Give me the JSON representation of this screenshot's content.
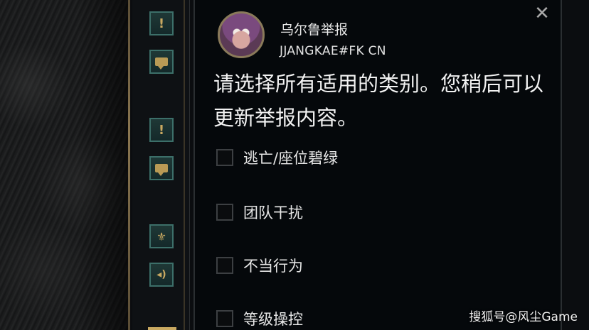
{
  "dialog": {
    "title": "乌尔鲁举报",
    "player_name": "JJANGKAE#FK CN",
    "instruction": "请选择所有适用的类别。您稍后可以更新举报内容。",
    "close_label": "✕"
  },
  "options": [
    {
      "label": "逃亡/座位碧绿",
      "checked": false
    },
    {
      "label": "团队干扰",
      "checked": false
    },
    {
      "label": "不当行为",
      "checked": false
    },
    {
      "label": "等级操控",
      "checked": false
    }
  ],
  "sidebar": {
    "buttons": [
      {
        "icon": "exclamation-icon",
        "glyph": "!"
      },
      {
        "icon": "chat-bubble-icon"
      },
      {
        "icon": "exclamation-icon",
        "glyph": "!"
      },
      {
        "icon": "chat-bubble-icon"
      },
      {
        "icon": "honor-icon",
        "glyph": "⚜"
      },
      {
        "icon": "speaker-icon",
        "glyph": "◂)"
      }
    ]
  },
  "watermark": "搜狐号@风尘Game",
  "colors": {
    "panel_bg": "#05080b",
    "side_button": "#1f3836",
    "gold_accent": "#c9a961"
  }
}
